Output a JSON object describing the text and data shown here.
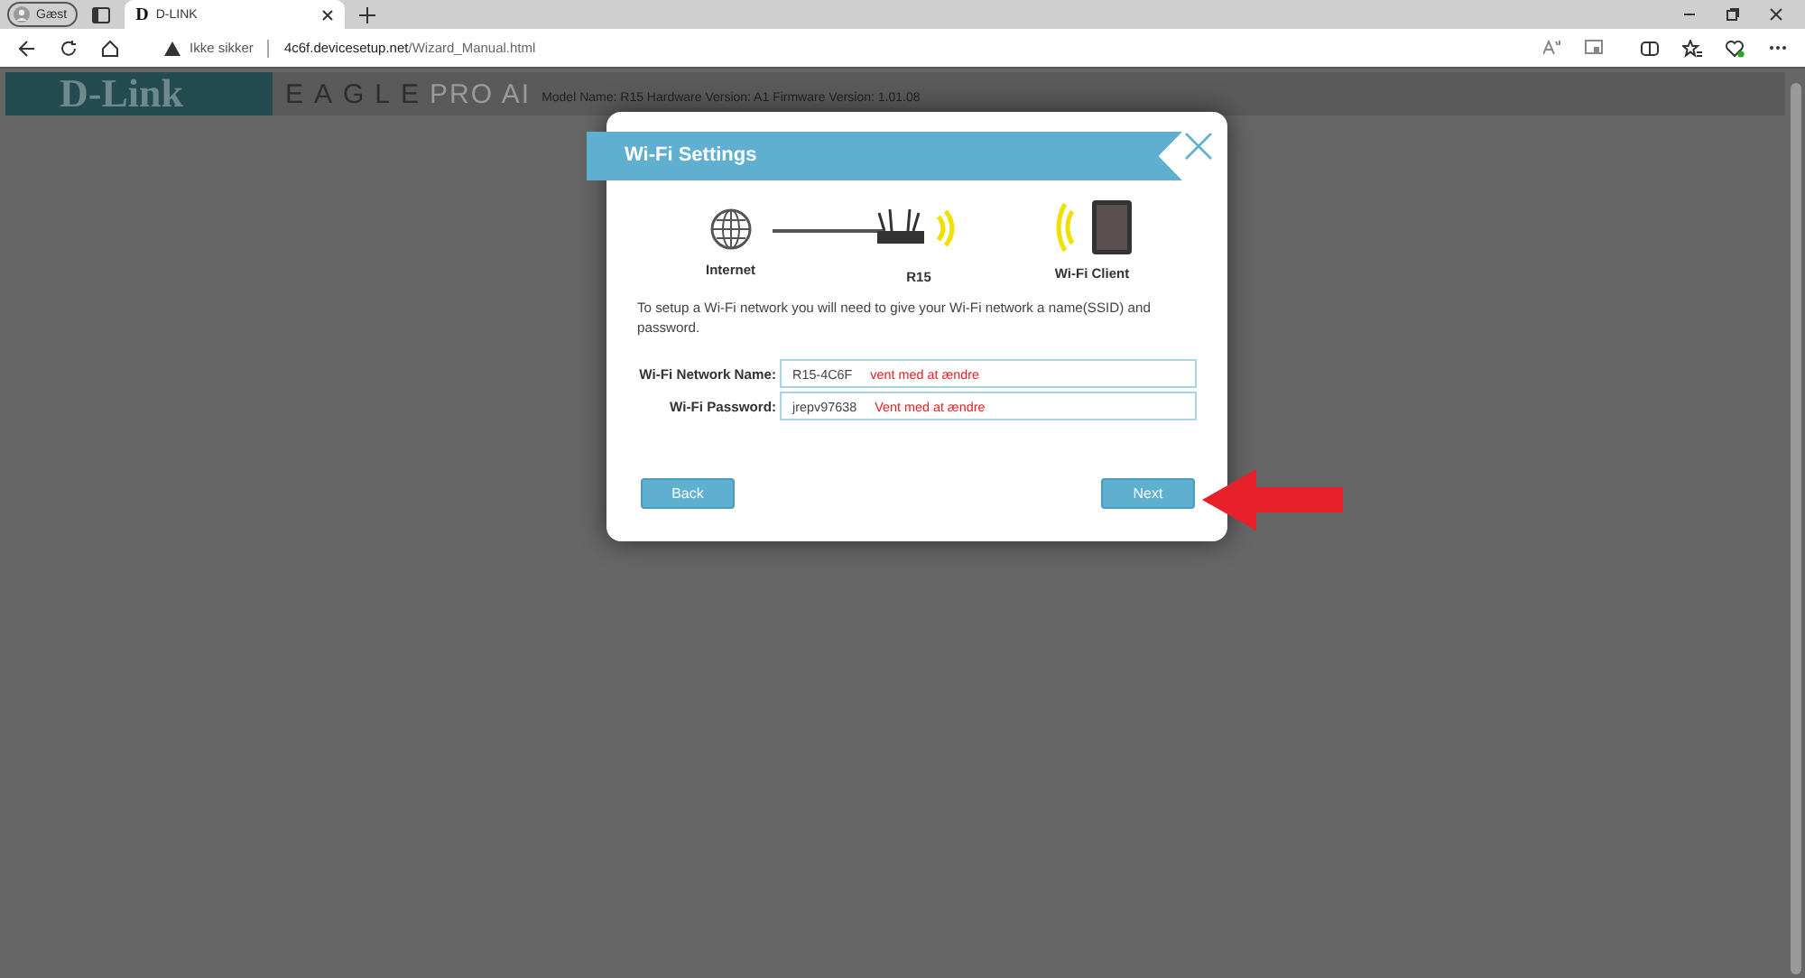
{
  "browser": {
    "profile": "Gæst",
    "tab_logo": "D",
    "tab_title": "D-LINK",
    "url_warning": "Ikke sikker",
    "url_host": "4c6f.devicesetup.net",
    "url_path": "/Wizard_Manual.html"
  },
  "header": {
    "logo": "D-Link",
    "product_a": "EAGLE",
    "product_b": "PRO AI",
    "model_info": "Model Name: R15 Hardware Version: A1 Firmware Version: 1.01.08"
  },
  "dialog": {
    "title": "Wi-Fi Settings",
    "diagram": [
      "Internet",
      "R15",
      "Wi-Fi Client"
    ],
    "description": "To setup a Wi-Fi network you will need to give your Wi-Fi network a name(SSID) and password.",
    "fields": [
      {
        "label": "Wi-Fi Network Name:",
        "value": "R15-4C6F",
        "note": "vent med at ændre"
      },
      {
        "label": "Wi-Fi Password:",
        "value": "jrepv97638",
        "note": "Vent med at ændre"
      }
    ],
    "back": "Back",
    "next": "Next"
  }
}
